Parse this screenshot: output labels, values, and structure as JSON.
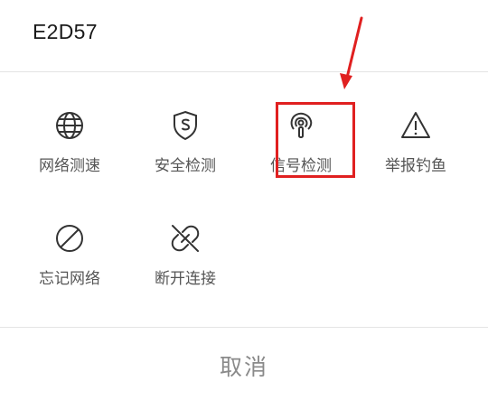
{
  "sheet": {
    "title": "E2D57",
    "actions_row1": [
      {
        "label": "网络测速",
        "icon": "globe-icon"
      },
      {
        "label": "安全检测",
        "icon": "shield-s-icon"
      },
      {
        "label": "信号检测",
        "icon": "signal-probe-icon"
      },
      {
        "label": "举报钓鱼",
        "icon": "warning-triangle-icon"
      }
    ],
    "actions_row2": [
      {
        "label": "忘记网络",
        "icon": "forbidden-circle-icon"
      },
      {
        "label": "断开连接",
        "icon": "broken-link-icon"
      }
    ],
    "cancel_label": "取消"
  },
  "annotation": {
    "color": "#e02020",
    "highlighted_action": "信号检测"
  },
  "colors": {
    "title": "#1a1a1a",
    "label": "#555555",
    "icon": "#333333",
    "cancel": "#8a8a8a",
    "divider": "#e4e4e4"
  }
}
